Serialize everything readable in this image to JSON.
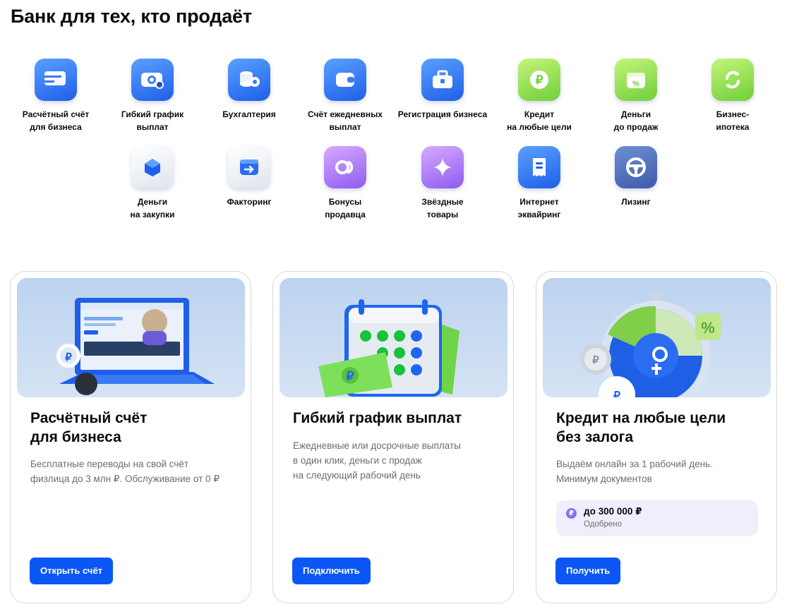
{
  "page": {
    "title": "Банк для тех, кто продаёт"
  },
  "services": [
    {
      "label": "Расчётный счёт\nдля бизнеса",
      "icon": "card-icon"
    },
    {
      "label": "Гибкий график выплат",
      "icon": "money-icon"
    },
    {
      "label": "Бухгалтерия",
      "icon": "coins-icon"
    },
    {
      "label": "Счёт ежедневных\nвыплат",
      "icon": "wallet-icon"
    },
    {
      "label": "Регистрация бизнеса",
      "icon": "briefcase-icon"
    },
    {
      "label": "Кредит\nна любые цели",
      "icon": "ruble-coin-icon"
    },
    {
      "label": "Деньги\nдо продаж",
      "icon": "percent-box-icon"
    },
    {
      "label": "Бизнес-\nипотека",
      "icon": "refresh-icon"
    },
    {
      "label": "Деньги\nна закупки",
      "icon": "cube-icon"
    },
    {
      "label": "Факторинг",
      "icon": "transfer-box-icon"
    },
    {
      "label": "Бонусы\nпродавца",
      "icon": "bonus-icon"
    },
    {
      "label": "Звёздные\nтовары",
      "icon": "star-icon"
    },
    {
      "label": "Интернет\nэквайринг",
      "icon": "receipt-icon"
    },
    {
      "label": "Лизинг",
      "icon": "steering-wheel-icon"
    }
  ],
  "cards": [
    {
      "title": "Расчётный счёт\nдля бизнеса",
      "description": "Бесплатные переводы на свой счёт\nфизлица до 3 млн ₽. Обслуживание от 0 ₽",
      "button": "Открыть счёт",
      "illustration": "laptop-illustration"
    },
    {
      "title": "Гибкий график выплат",
      "description": "Ежедневные или досрочные выплаты\nв один клик, деньги с продаж\nна следующий рабочий день",
      "button": "Подключить",
      "illustration": "calendar-illustration"
    },
    {
      "title": "Кредит на любые цели\nбез залога",
      "description": "Выдаём онлайн за 1 рабочий день.\nМинимум документов",
      "button": "Получить",
      "illustration": "stopwatch-illustration",
      "pill": {
        "icon": "₽",
        "amount": "до 300 000 ₽",
        "status": "Одобрено"
      }
    }
  ],
  "colors": {
    "accent": "#0b57f5",
    "card_border": "#d5d8de",
    "muted_text": "#6a6d75",
    "pill_bg": "#eeeffb"
  }
}
